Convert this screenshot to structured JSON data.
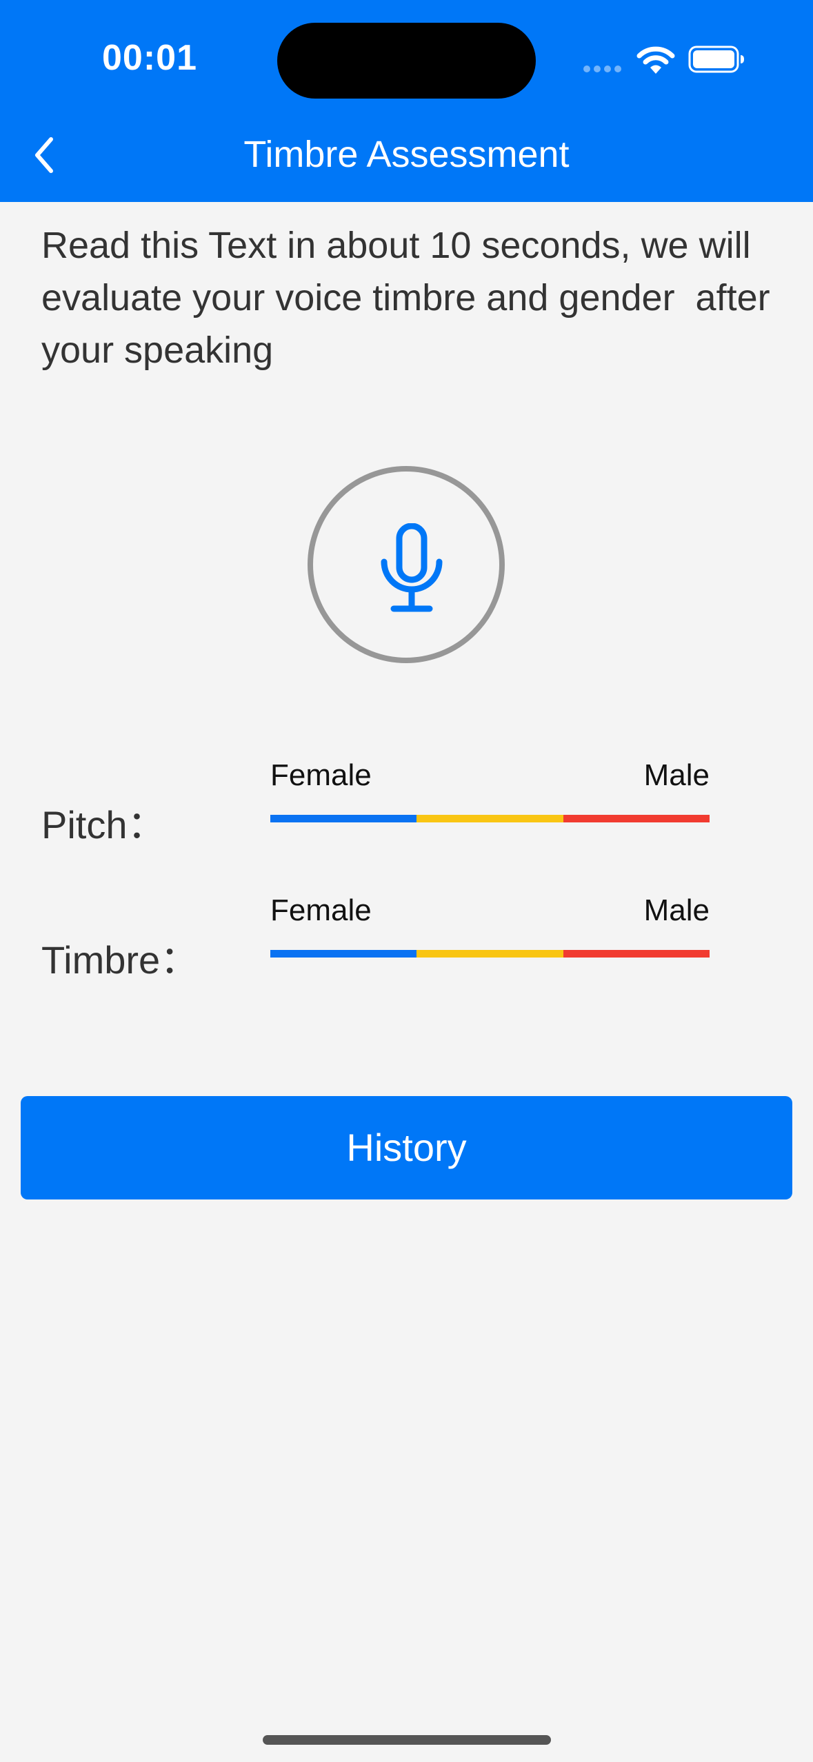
{
  "status_bar": {
    "time": "00:01",
    "icons": [
      "cellular-signal-icon",
      "wifi-icon",
      "battery-icon"
    ]
  },
  "nav": {
    "title": "Timbre Assessment",
    "back_icon": "chevron-left-icon"
  },
  "instruction": "Read this Text in about 10 seconds, we will evaluate your voice timbre and gender  after your speaking",
  "mic": {
    "icon": "microphone-icon"
  },
  "scales": [
    {
      "label": "Pitch：",
      "left_end": "Female",
      "right_end": "Male"
    },
    {
      "label": "Timbre：",
      "left_end": "Female",
      "right_end": "Male"
    }
  ],
  "scale_colors": [
    "#0a72f2",
    "#f9c513",
    "#f13b30"
  ],
  "history_button": "History",
  "colors": {
    "accent": "#0077f7",
    "background": "#f4f4f4",
    "ring": "#979797"
  }
}
